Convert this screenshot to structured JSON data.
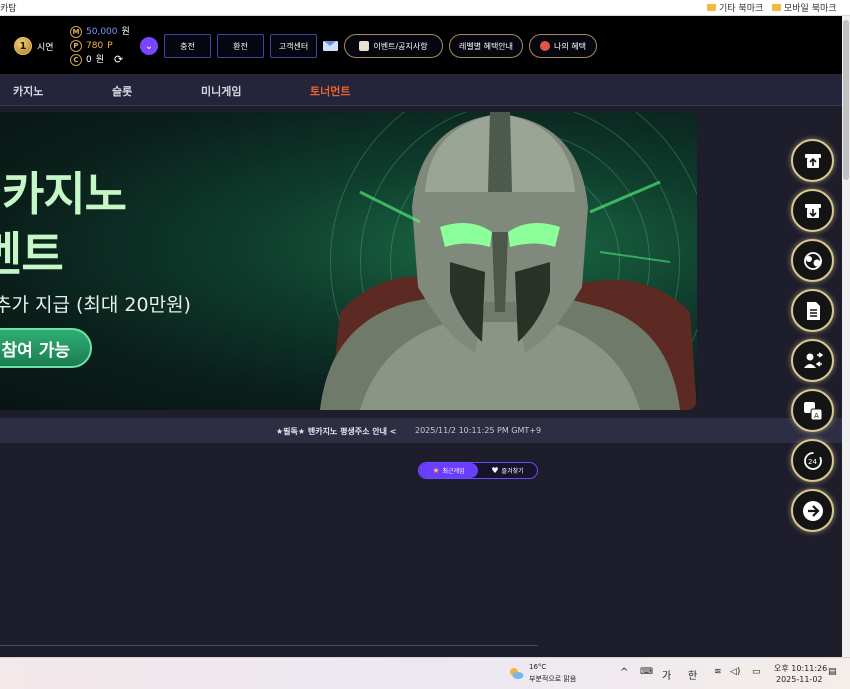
{
  "browser": {
    "left_fragment": "카탐",
    "bookmarks": [
      "기타 북마크",
      "모바일 북마크"
    ]
  },
  "header": {
    "level_number": "1",
    "username": "시연",
    "balances": [
      {
        "icon": "M",
        "value": "50,000",
        "unit": "원"
      },
      {
        "icon": "P",
        "value": "780",
        "unit": "P"
      },
      {
        "icon": "C",
        "value": "0",
        "unit": "원"
      }
    ],
    "buttons": [
      "충전",
      "환전",
      "고객센터"
    ],
    "pills": [
      "이벤트/공지사항",
      "레벨별 혜택안내",
      "나의 혜택"
    ]
  },
  "nav": {
    "items": [
      "카지노",
      "슬롯",
      "미니게임",
      "토너먼트"
    ],
    "active_index": 3,
    "active_color": "#e9622f"
  },
  "banner": {
    "title_line1": "카지노",
    "title_line2": "벤트",
    "subtitle": "추가 지급 (최대 20만원)",
    "cta": "참여 가능"
  },
  "ticker": {
    "text": "★필독★ 텐카지노 평생주소 안내 <",
    "timestamp": "2025/11/2 10:11:25 PM GMT+9"
  },
  "tabs": [
    {
      "label": "최근게임",
      "icon": "star-icon",
      "active": true
    },
    {
      "label": "즐겨찾기",
      "icon": "heart-icon",
      "active": false
    }
  ],
  "side_buttons": [
    "deposit-icon",
    "withdraw-icon",
    "point-exchange-icon",
    "document-icon",
    "user-switch-icon",
    "translate-icon",
    "support-24-icon",
    "logout-icon"
  ],
  "taskbar": {
    "temperature": "16°C",
    "weather": "부분적으로 맑음",
    "ime1": "가",
    "ime2": "한",
    "time": "오후 10:11:26",
    "date": "2025-11-02"
  },
  "colors": {
    "accent_purple": "#6a3dff",
    "gold": "#d8c892",
    "banner_green": "#1b6b46"
  }
}
